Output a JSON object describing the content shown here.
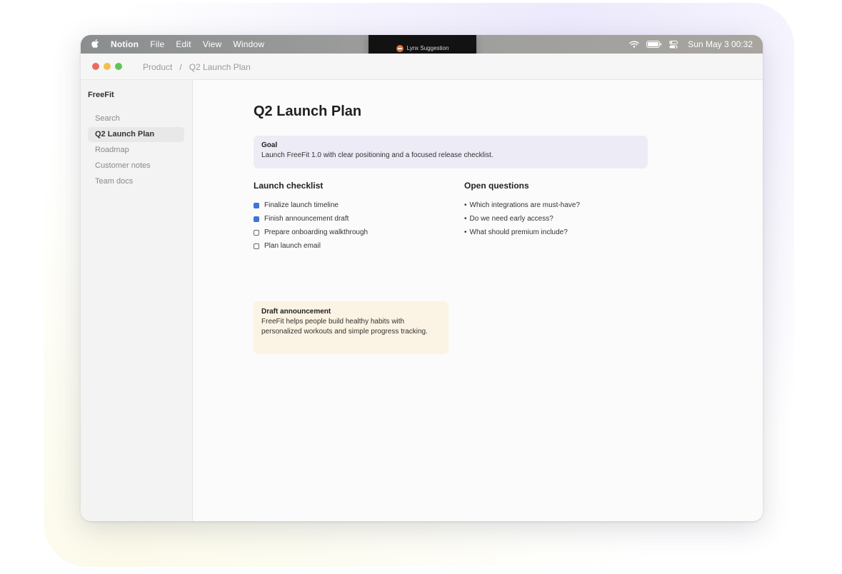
{
  "menubar": {
    "app_name": "Notion",
    "menus": [
      "File",
      "Edit",
      "View",
      "Window"
    ],
    "clock": "Sun May 3 00:32",
    "icons": [
      "apple-icon",
      "wifi-icon",
      "battery-icon",
      "control-center-icon"
    ]
  },
  "notch": {
    "label": "Lynx Suggestion",
    "icon": "lynx-icon",
    "icon_color": "#e2703a"
  },
  "titlebar": {
    "breadcrumb": [
      "Product",
      "Q2 Launch Plan"
    ],
    "separator": "/"
  },
  "sidebar": {
    "workspace": "FreeFit",
    "items": [
      {
        "label": "Search",
        "active": false
      },
      {
        "label": "Q2 Launch Plan",
        "active": true
      },
      {
        "label": "Roadmap",
        "active": false
      },
      {
        "label": "Customer notes",
        "active": false
      },
      {
        "label": "Team docs",
        "active": false
      }
    ]
  },
  "page": {
    "title": "Q2 Launch Plan",
    "goal": {
      "heading": "Goal",
      "text": "Launch FreeFit 1.0 with clear positioning and a focused release checklist."
    },
    "checklist": {
      "heading": "Launch checklist",
      "items": [
        {
          "label": "Finalize launch timeline",
          "checked": true
        },
        {
          "label": "Finish announcement draft",
          "checked": true
        },
        {
          "label": "Prepare onboarding walkthrough",
          "checked": false
        },
        {
          "label": "Plan launch email",
          "checked": false
        }
      ]
    },
    "questions": {
      "heading": "Open questions",
      "bullet": "•",
      "items": [
        "Which integrations are must-have?",
        "Do we need early access?",
        "What should premium include?"
      ]
    },
    "draft": {
      "heading": "Draft announcement",
      "text": "FreeFit helps people build healthy habits with personalized workouts and simple progress tracking."
    }
  },
  "colors": {
    "accent_check": "#3f74d8",
    "goal_bg": "#ecebf6",
    "draft_bg": "#fbf3e3"
  }
}
